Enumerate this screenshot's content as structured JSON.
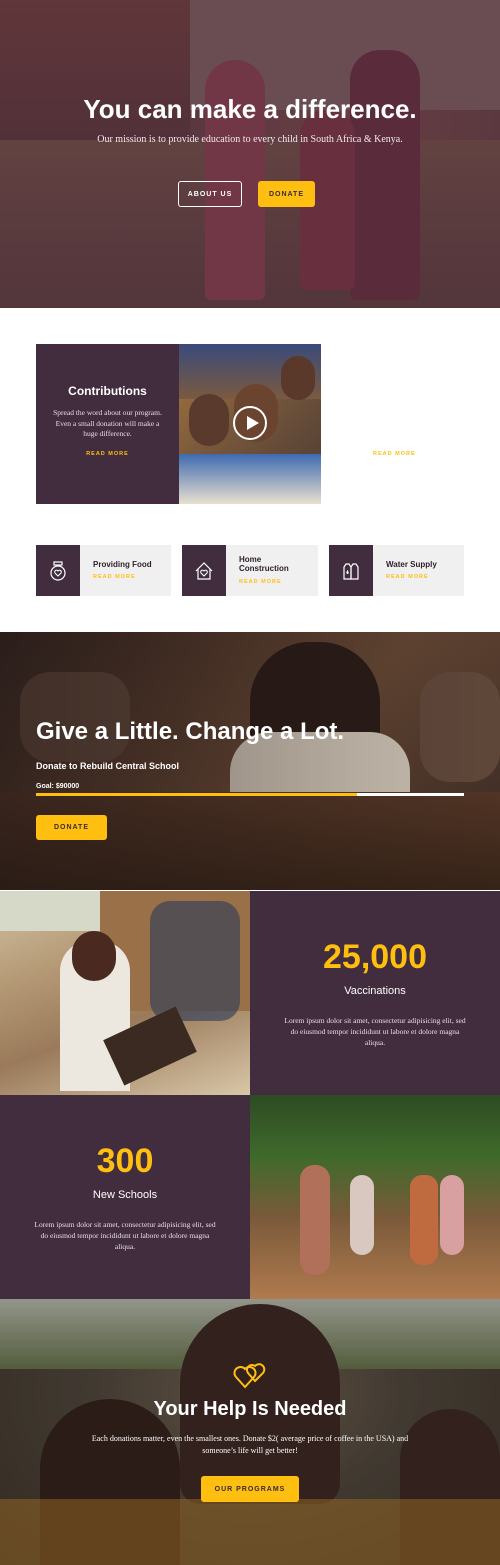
{
  "hero": {
    "title": "You can make a difference.",
    "subtitle": "Our mission is to provide education to every child in South Africa & Kenya.",
    "about_label": "ABOUT US",
    "donate_label": "DONATE"
  },
  "contributions": {
    "title": "Contributions",
    "text": "Spread the word about our program. Even a small donation will make a huge difference.",
    "read_more": "READ MORE",
    "read_more_2": "READ MORE"
  },
  "services": [
    {
      "title": "Providing Food",
      "read_more": "READ MORE",
      "icon": "food-jar-icon"
    },
    {
      "title": "Home Construction",
      "read_more": "READ MORE",
      "icon": "home-heart-icon"
    },
    {
      "title": "Water Supply",
      "read_more": "READ MORE",
      "icon": "water-bottles-icon"
    }
  ],
  "school": {
    "title": "Give a Little. Change a Lot.",
    "subtitle": "Donate to Rebuild Central School",
    "goal": "Goal: $90000",
    "progress_percent": 75,
    "donate_label": "DONATE"
  },
  "stats": [
    {
      "number": "25,000",
      "label": "Vaccinations",
      "text": "Lorem ipsum dolor sit amet, consectetur adipisicing elit, sed do eiusmod tempor incididunt ut labore et dolore magna aliqua."
    },
    {
      "number": "300",
      "label": "New Schools",
      "text": "Lorem ipsum dolor sit amet, consectetur adipisicing elit, sed do eiusmod tempor incididunt ut labore et dolore magna aliqua."
    }
  ],
  "help": {
    "title": "Your Help Is Needed",
    "text": "Each donations matter, even the smallest ones. Donate $2( average price of coffee in the USA) and someone’s life will get better!",
    "button_label": "OUR PROGRAMS"
  },
  "colors": {
    "accent": "#ffbf10",
    "plum": "#412d3d"
  }
}
